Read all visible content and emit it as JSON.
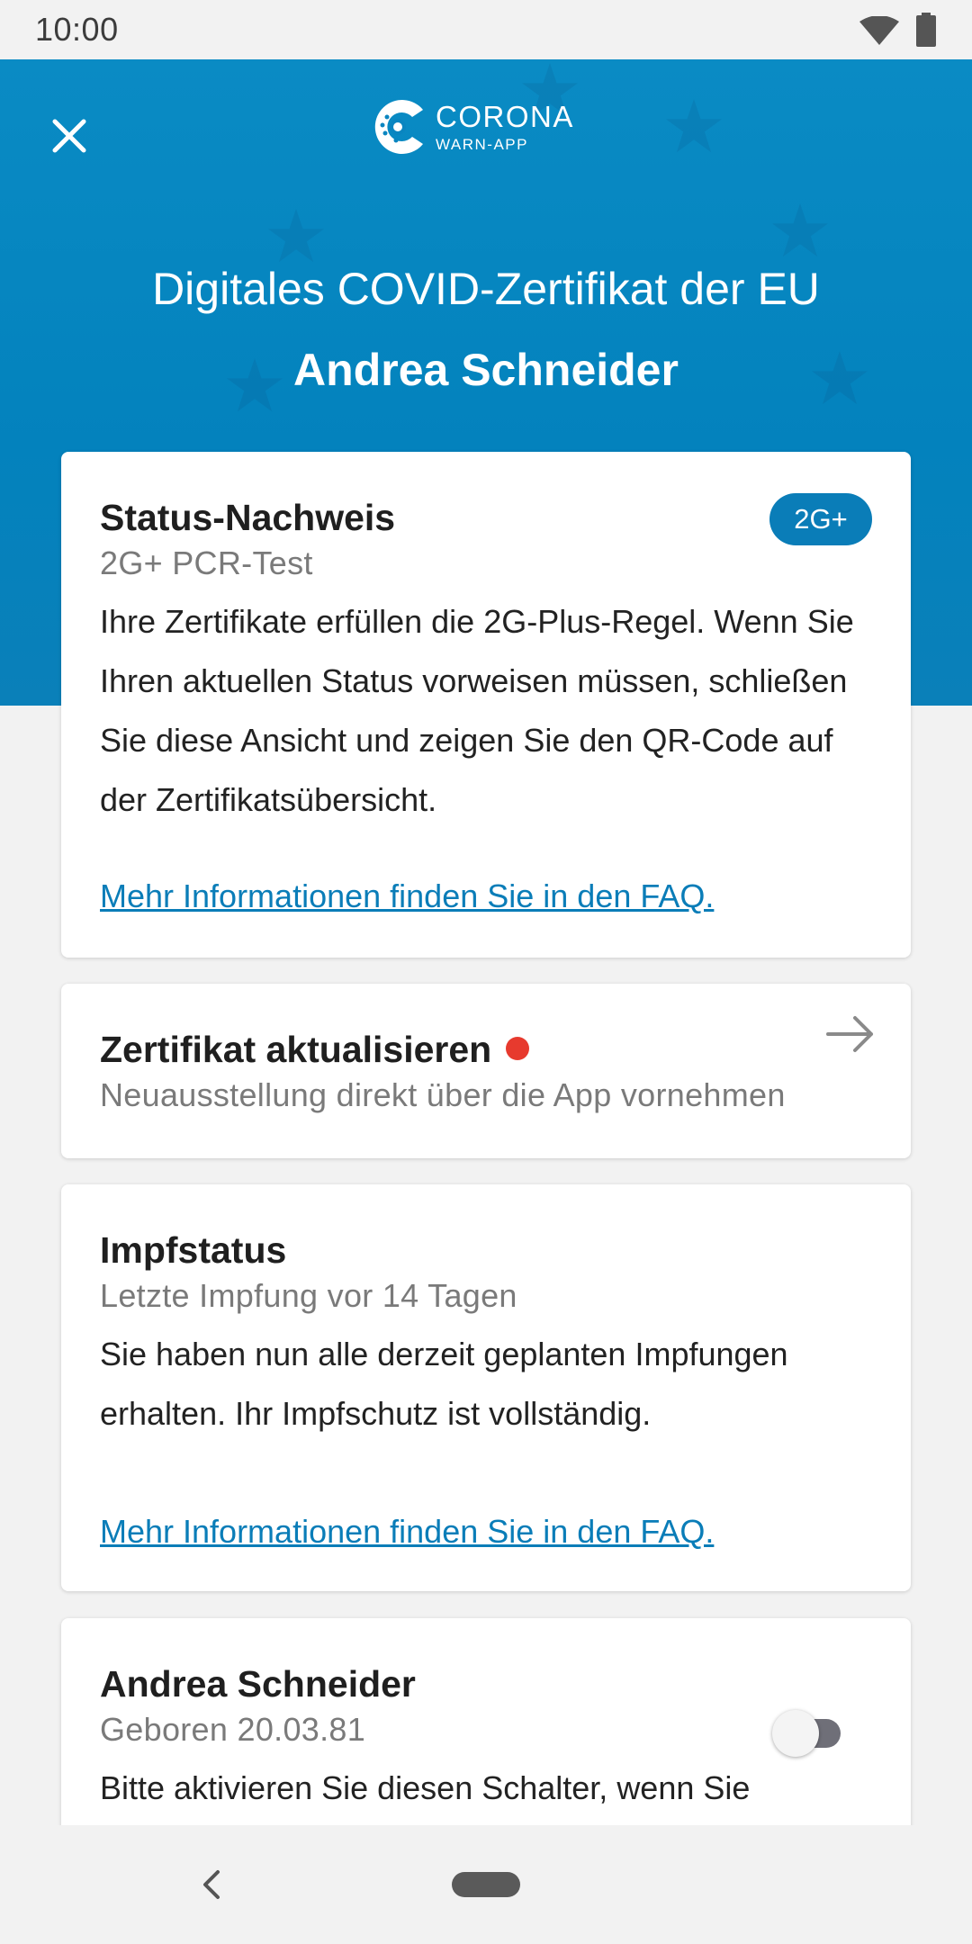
{
  "status_bar": {
    "time": "10:00",
    "wifi_icon": "wifi-icon",
    "battery_icon": "battery-icon"
  },
  "header": {
    "close_icon": "close-icon",
    "logo": {
      "line1": "CORONA",
      "line2": "WARN-APP"
    },
    "title": "Digitales COVID-Zertifikat der EU",
    "name": "Andrea Schneider",
    "background_color": "#0a85c0"
  },
  "status_card": {
    "title": "Status-Nachweis",
    "badge": "2G+",
    "subtitle": "2G+ PCR-Test",
    "body": "Ihre Zertifikate erfüllen die 2G-Plus-Regel. Wenn Sie Ihren aktuellen Status vorweisen müssen, schließen Sie diese Ansicht und zeigen Sie den QR-Code auf der Zertifikatsübersicht.",
    "link": "Mehr Informationen finden Sie in den FAQ."
  },
  "update_card": {
    "title": "Zertifikat aktualisieren",
    "subtitle": "Neuausstellung direkt über die App vornehmen",
    "dot_color": "#e73a2e",
    "arrow_icon": "arrow-right-icon"
  },
  "vaccination_card": {
    "title": "Impfstatus",
    "subtitle": "Letzte Impfung vor 14 Tagen",
    "body": "Sie haben nun alle derzeit geplanten Impfungen erhalten. Ihr Impfschutz ist vollständig.",
    "link": "Mehr Informationen finden Sie in den FAQ."
  },
  "person_card": {
    "title": "Andrea Schneider",
    "subtitle": "Geboren 20.03.81",
    "body": "Bitte aktivieren Sie diesen Schalter, wenn Sie",
    "toggle_on": false
  },
  "nav_bar": {
    "back_icon": "back-icon",
    "home_icon": "home-pill-icon"
  },
  "colors": {
    "accent": "#0a7db8",
    "background": "#f2f2f2"
  }
}
